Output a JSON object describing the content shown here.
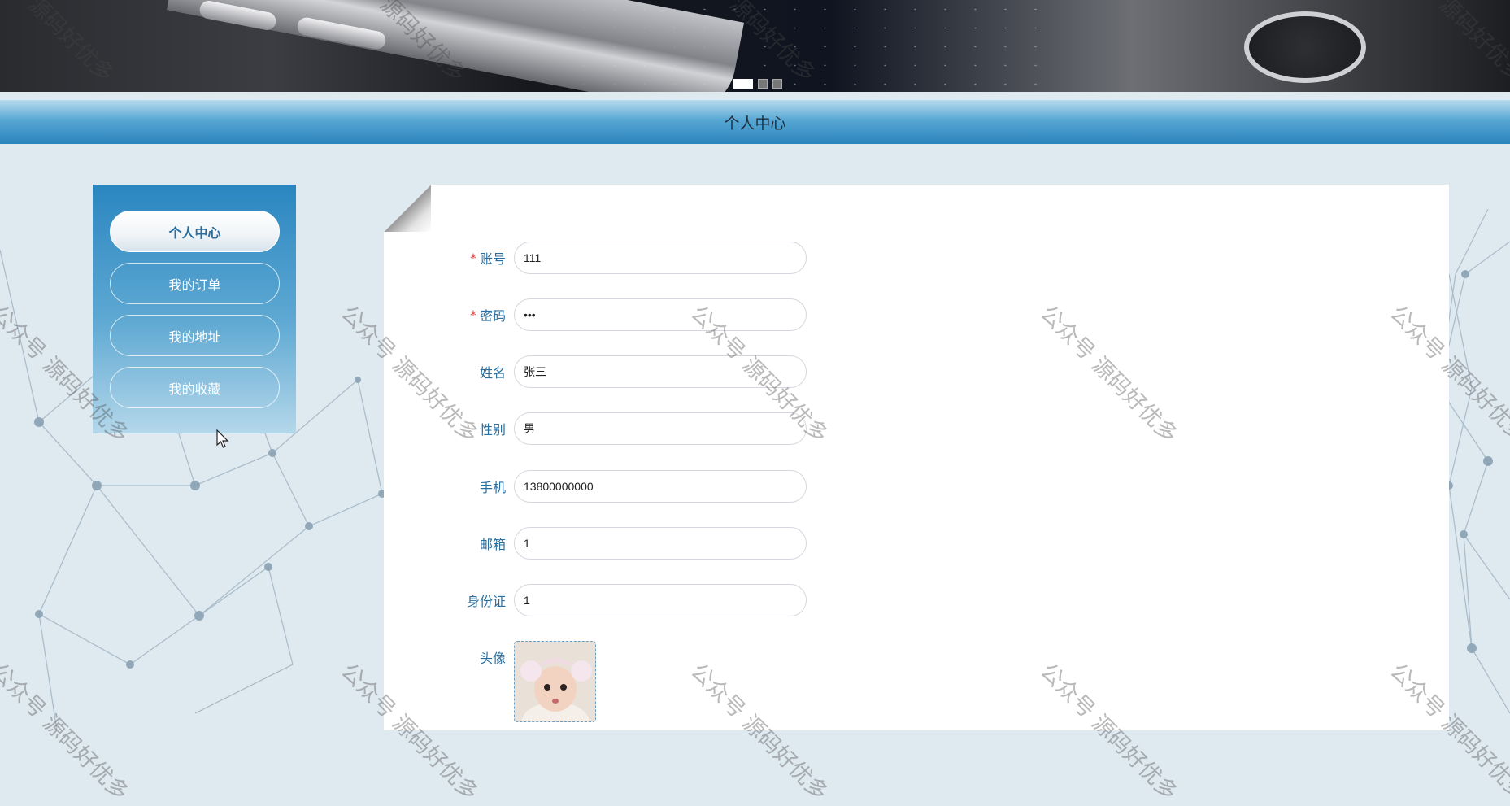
{
  "banner": {
    "slides": [
      {
        "label": "slide-1",
        "active": true
      },
      {
        "label": "slide-2",
        "active": false
      },
      {
        "label": "slide-3",
        "active": false
      }
    ]
  },
  "page_title": "个人中心",
  "sidebar": {
    "items": [
      {
        "label": "个人中心",
        "active": true
      },
      {
        "label": "我的订单",
        "active": false
      },
      {
        "label": "我的地址",
        "active": false
      },
      {
        "label": "我的收藏",
        "active": false
      }
    ]
  },
  "form": {
    "account": {
      "label": "账号",
      "required": true,
      "value": "111"
    },
    "password": {
      "label": "密码",
      "required": true,
      "value": "•••"
    },
    "name": {
      "label": "姓名",
      "required": false,
      "value": "张三"
    },
    "gender": {
      "label": "性别",
      "required": false,
      "value": "男"
    },
    "phone": {
      "label": "手机",
      "required": false,
      "value": "13800000000"
    },
    "email": {
      "label": "邮箱",
      "required": false,
      "value": "1"
    },
    "id_card": {
      "label": "身份证",
      "required": false,
      "value": "1"
    },
    "avatar": {
      "label": "头像"
    }
  },
  "required_mark": "*",
  "watermark": {
    "text": "公众号 源码好优多",
    "partial": "源码好优多"
  },
  "colors": {
    "accent": "#2a86c0",
    "label": "#2a6e9e",
    "required": "#e04545"
  }
}
